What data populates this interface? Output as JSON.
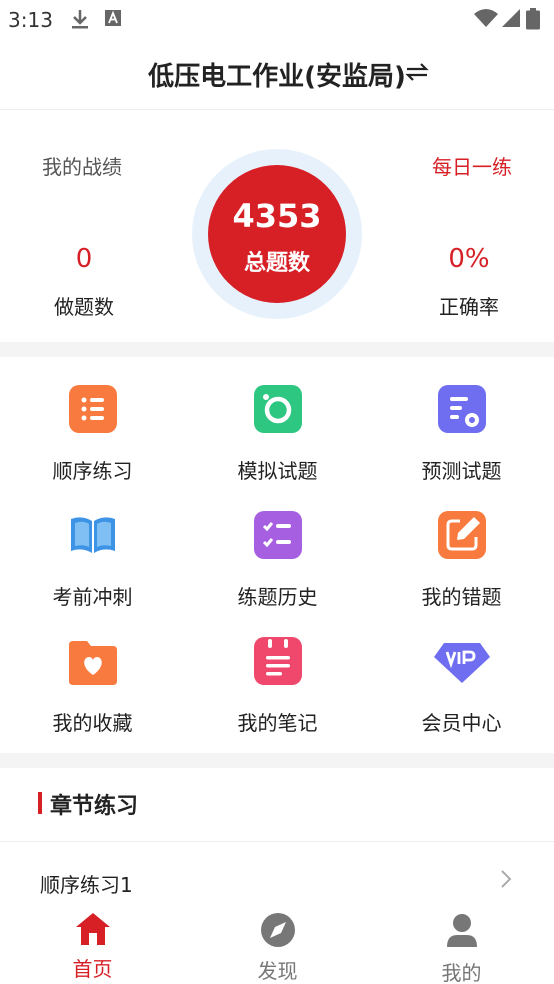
{
  "status_bar": {
    "time": "3:13"
  },
  "header": {
    "title": "低压电工作业(安监局)"
  },
  "stats": {
    "my_record_label": "我的战绩",
    "daily_practice_label": "每日一练",
    "done_count": "0",
    "done_label": "做题数",
    "total_count": "4353",
    "total_label": "总题数",
    "accuracy": "0%",
    "accuracy_label": "正确率"
  },
  "menu": [
    {
      "label": "顺序练习",
      "icon": "list-icon",
      "color": "#f97a3e"
    },
    {
      "label": "模拟试题",
      "icon": "camera-icon",
      "color": "#2dc781"
    },
    {
      "label": "预测试题",
      "icon": "document-gear-icon",
      "color": "#6f6ef0"
    },
    {
      "label": "考前冲刺",
      "icon": "open-book-icon",
      "color": "#3d93e6"
    },
    {
      "label": "练题历史",
      "icon": "checklist-icon",
      "color": "#a65fe0"
    },
    {
      "label": "我的错题",
      "icon": "edit-icon",
      "color": "#f97a3e"
    },
    {
      "label": "我的收藏",
      "icon": "heart-folder-icon",
      "color": "#f97a3e"
    },
    {
      "label": "我的笔记",
      "icon": "notebook-icon",
      "color": "#f0476c"
    },
    {
      "label": "会员中心",
      "icon": "vip-diamond-icon",
      "color": "#6f6ef0"
    }
  ],
  "chapter_section": {
    "title": "章节练习",
    "items": [
      {
        "label": "顺序练习1"
      }
    ]
  },
  "bottom_nav": [
    {
      "label": "首页",
      "icon": "home-icon",
      "active": true
    },
    {
      "label": "发现",
      "icon": "compass-icon",
      "active": false
    },
    {
      "label": "我的",
      "icon": "user-icon",
      "active": false
    }
  ],
  "colors": {
    "accent": "#d71f26",
    "inactive": "#777777"
  }
}
